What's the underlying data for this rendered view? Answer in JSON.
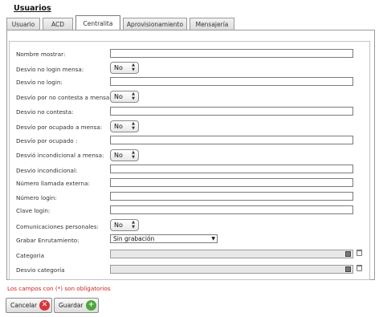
{
  "page": {
    "title": "Usuarios"
  },
  "tabs": [
    {
      "label": "Usuario",
      "active": false
    },
    {
      "label": "ACD",
      "active": false
    },
    {
      "label": "Centralita",
      "active": true
    },
    {
      "label": "Aprovisionamiento",
      "active": false
    },
    {
      "label": "Mensajería",
      "active": false
    }
  ],
  "form": {
    "nombre_mostrar": {
      "label": "Nombre mostrar:",
      "value": ""
    },
    "desvio_no_login_mensa": {
      "label": "Desvío no login mensa:",
      "value": "No"
    },
    "desvio_no_login": {
      "label": "Desvío no login:",
      "value": ""
    },
    "desvio_no_contesta_mensa": {
      "label": "Desvío por no contesta a mensa :",
      "value": "No"
    },
    "desvio_no_contesta": {
      "label": "Desvio no contesta:",
      "value": ""
    },
    "desvio_ocupado_mensa": {
      "label": "Desvío por ocupado a mensa:",
      "value": "No"
    },
    "desvio_ocupado": {
      "label": "Desvío por ocupado :",
      "value": ""
    },
    "desvio_incondicional_mensa": {
      "label": "Desvió incondicional a mensa:",
      "value": "No"
    },
    "desvio_incondicional": {
      "label": "Desvio incondicional:",
      "value": ""
    },
    "numero_llamada_externa": {
      "label": "Número llamada externa:",
      "value": ""
    },
    "numero_login": {
      "label": "Número login:",
      "value": ""
    },
    "clave_login": {
      "label": "Clave login:",
      "value": ""
    },
    "comunicaciones_personales": {
      "label": "Comunicaciones personales:",
      "value": "No"
    },
    "grabar_enrutamiento": {
      "label": "Grabar Enrutamiento:",
      "value": "Sin grabación"
    },
    "categoria": {
      "label": "Categoria",
      "value": ""
    },
    "desvio_categoria": {
      "label": "Desvio categoría",
      "value": ""
    }
  },
  "note": "Los campos con (*) son obligatorios",
  "buttons": {
    "cancel": "Cancelar",
    "save": "Guardar"
  },
  "icons": {
    "cancel": "cancel-icon",
    "save": "save-icon",
    "picker": "picker-icon",
    "trash": "trash-icon"
  },
  "colors": {
    "required_note": "#cc1f1f",
    "cancel_icon": "#d9333b",
    "save_icon": "#4aa83a"
  }
}
